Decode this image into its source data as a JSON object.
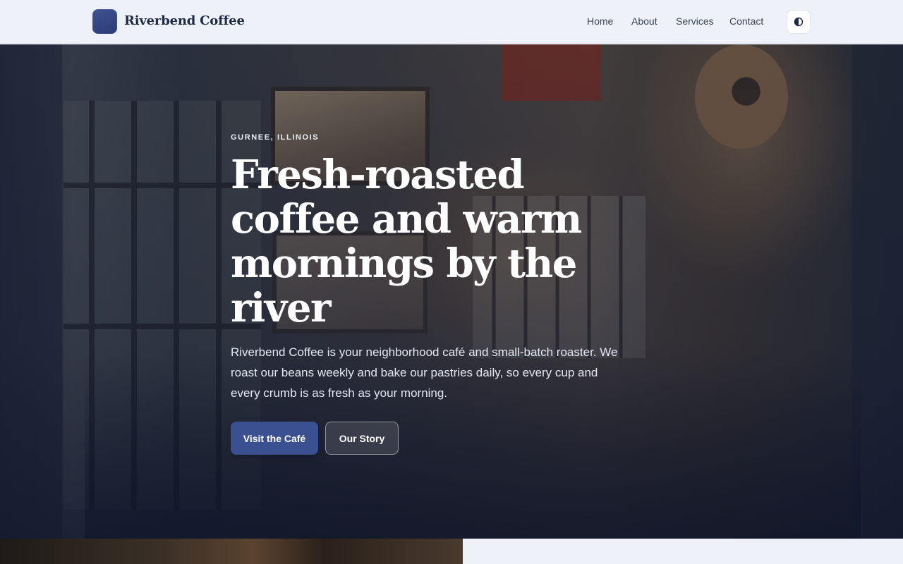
{
  "header": {
    "brand": "Riverbend Coffee",
    "logo_icon": "logo-mark-icon",
    "nav": [
      "Home",
      "About",
      "Services",
      "Contact"
    ],
    "theme_toggle_icon": "contrast-half-circle-icon"
  },
  "hero": {
    "eyebrow": "GURNEE, ILLINOIS",
    "headline": "Fresh-roasted coffee and warm mornings by the river",
    "lead": "Riverbend Coffee is your neighborhood café and small-batch roaster. We roast our beans weekly and bake our pastries daily, so every cup and every crumb is as fresh as your morning.",
    "primary_cta": "Visit the Café",
    "secondary_cta": "Our Story"
  },
  "colors": {
    "accent": "#3b5091",
    "header_bg": "#eef1f8",
    "brand_text": "#1f2a44"
  }
}
